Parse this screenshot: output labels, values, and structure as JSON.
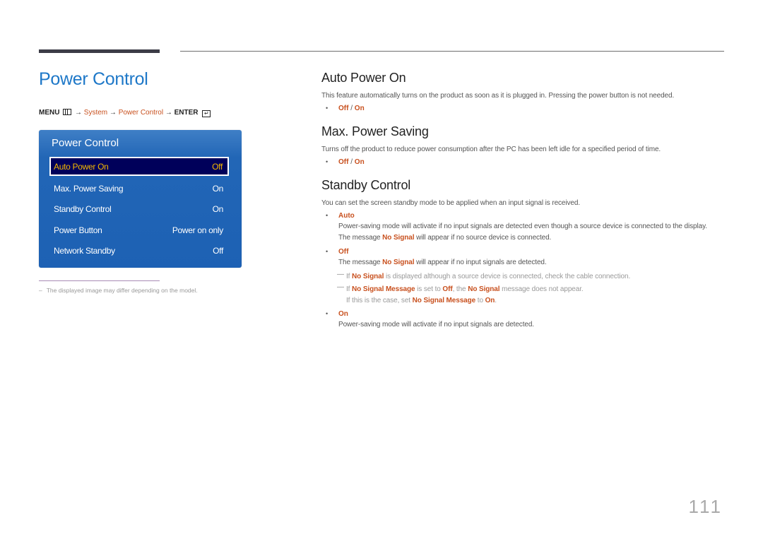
{
  "page": {
    "title": "Power Control",
    "page_number": "111"
  },
  "menu_path": {
    "menu": "MENU",
    "menu_icon": "menu-icon",
    "arrow": "→",
    "system": "System",
    "power_control": "Power Control",
    "enter": "ENTER",
    "enter_icon": "enter-icon"
  },
  "osd": {
    "title": "Power Control",
    "items": [
      {
        "label": "Auto Power On",
        "value": "Off",
        "selected": true
      },
      {
        "label": "Max. Power Saving",
        "value": "On",
        "selected": false
      },
      {
        "label": "Standby Control",
        "value": "On",
        "selected": false
      },
      {
        "label": "Power Button",
        "value": "Power on only",
        "selected": false
      },
      {
        "label": "Network Standby",
        "value": "Off",
        "selected": false
      }
    ]
  },
  "footnote": {
    "dash": "–",
    "text": "The displayed image may differ depending on the model."
  },
  "sections": {
    "auto_power_on": {
      "heading": "Auto Power On",
      "desc": "This feature automatically turns on the product as soon as it is plugged in. Pressing the power button is not needed.",
      "options": {
        "off": "Off",
        "sep": " / ",
        "on": "On"
      }
    },
    "max_power_saving": {
      "heading": "Max. Power Saving",
      "desc": "Turns off the product to reduce power consumption after the PC has been left idle for a specified period of time.",
      "options": {
        "off": "Off",
        "sep": " / ",
        "on": "On"
      }
    },
    "standby_control": {
      "heading": "Standby Control",
      "desc": "You can set the screen standby mode to be applied when an input signal is received.",
      "auto": {
        "label": "Auto",
        "line1": "Power-saving mode will activate if no input signals are detected even though a source device is connected to the display.",
        "line2_pre": "The message ",
        "line2_hl": "No Signal",
        "line2_post": " will appear if no source device is connected."
      },
      "off": {
        "label": "Off",
        "line1_pre": "The message ",
        "line1_hl": "No Signal",
        "line1_post": " will appear if no input signals are detected.",
        "note1": {
          "pre": "If ",
          "hl": "No Signal",
          "post": " is displayed although a source device is connected, check the cable connection."
        },
        "note2": {
          "pre": "If ",
          "hl1": "No Signal Message",
          "mid1": " is set to ",
          "hl2": "Off",
          "mid2": ", the ",
          "hl3": "No Signal",
          "post": " message does not appear.",
          "line2_pre": "If this is the case, set ",
          "line2_hl1": "No Signal Message",
          "line2_mid": " to ",
          "line2_hl2": "On",
          "line2_post": "."
        }
      },
      "on": {
        "label": "On",
        "line1": "Power-saving mode will activate if no input signals are detected."
      }
    }
  },
  "colors": {
    "title_blue": "#1e78c8",
    "accent_orange": "#c8501e",
    "osd_blue": "#1d61b4",
    "osd_selected_bg": "#00005a",
    "osd_selected_text": "#f5b800"
  }
}
